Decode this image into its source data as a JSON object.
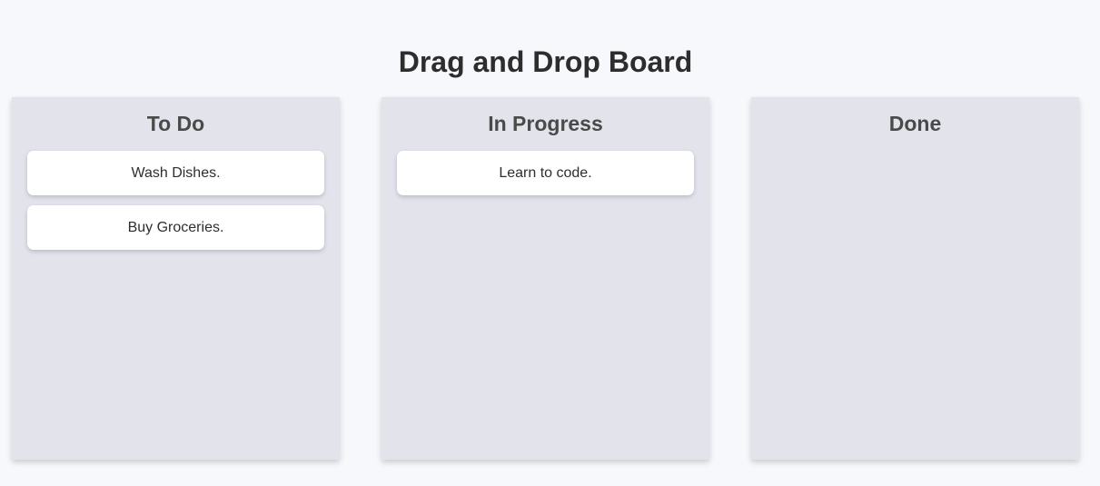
{
  "board": {
    "title": "Drag and Drop Board"
  },
  "columns": [
    {
      "title": "To Do",
      "cards": [
        "Wash Dishes.",
        "Buy Groceries."
      ]
    },
    {
      "title": "In Progress",
      "cards": [
        "Learn to code."
      ]
    },
    {
      "title": "Done",
      "cards": []
    }
  ]
}
